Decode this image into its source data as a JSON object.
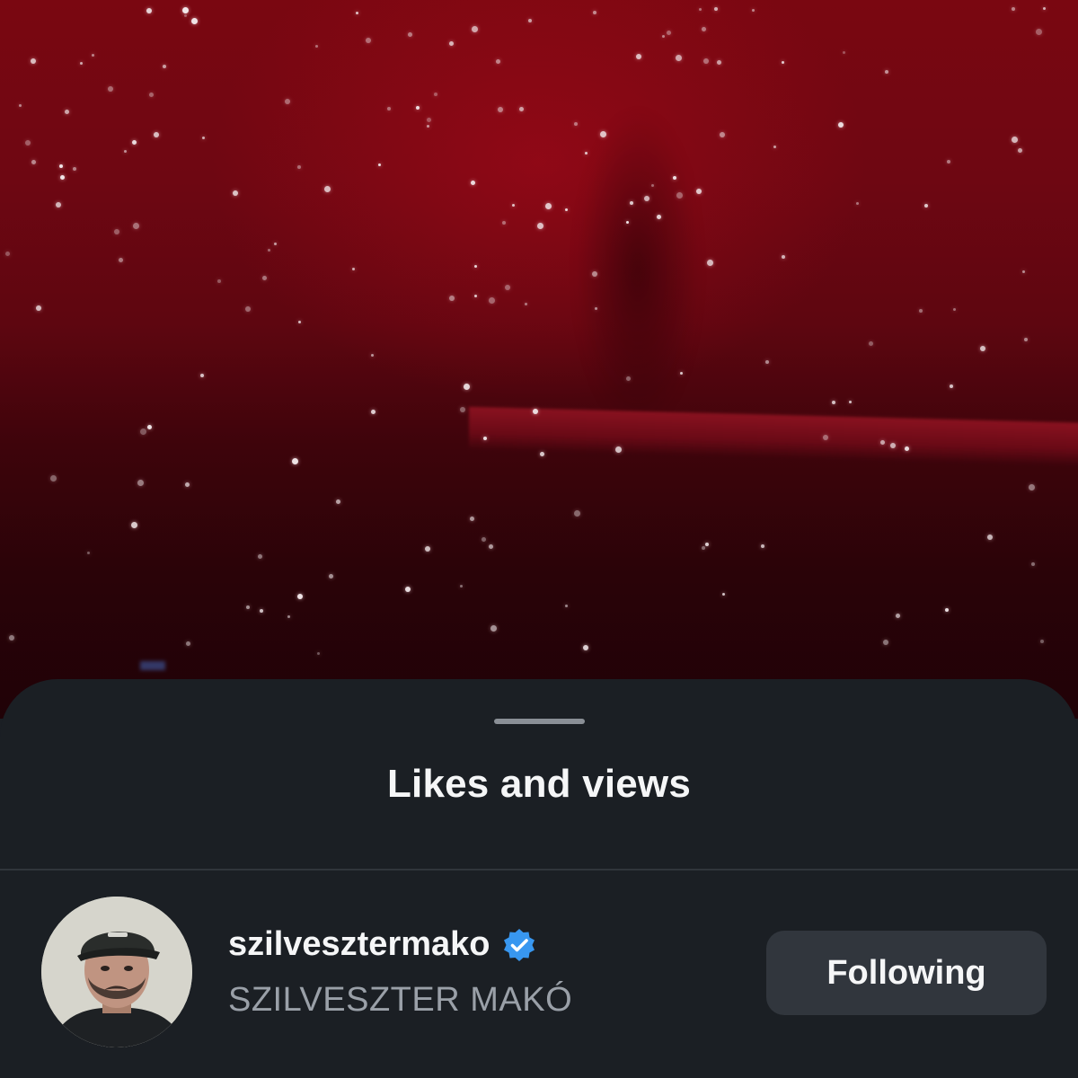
{
  "sheet": {
    "title": "Likes and views"
  },
  "viewer": {
    "username": "szilvesztermako",
    "full_name": "SZILVESZTER MAKÓ",
    "verified": true,
    "follow_button_label": "Following"
  },
  "colors": {
    "sheet_background": "#1b1f24",
    "button_background": "#31363d",
    "verified_badge": "#3897f0",
    "secondary_text": "#9aa0a8",
    "media_tint": "#6e0712"
  },
  "icons": {
    "verified": "verified-badge-icon"
  }
}
